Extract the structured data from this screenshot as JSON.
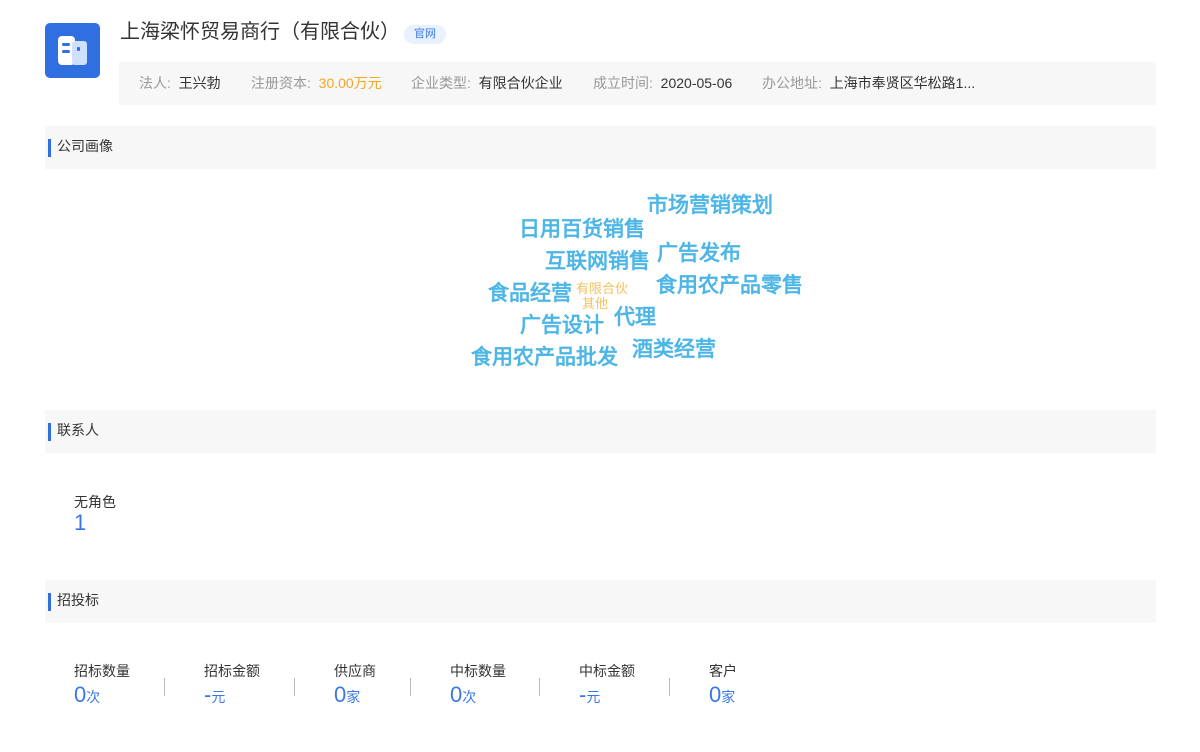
{
  "company": {
    "name": "上海梁怀贸易商行（有限合伙）",
    "official_tag": "官网"
  },
  "info": {
    "legal_rep_label": "法人:",
    "legal_rep": "王兴勃",
    "capital_label": "注册资本:",
    "capital": "30.00万元",
    "type_label": "企业类型:",
    "type": "有限合伙企业",
    "founded_label": "成立时间:",
    "founded": "2020-05-06",
    "address_label": "办公地址:",
    "address": "上海市奉贤区华松路1..."
  },
  "sections": {
    "profile": "公司画像",
    "contacts": "联系人",
    "bidding": "招投标"
  },
  "word_cloud": {
    "primary_color": "#4db6e6",
    "secondary_color": "#f5c15a",
    "words": [
      {
        "text": "市场营销策划"
      },
      {
        "text": "日用百货销售"
      },
      {
        "text": "互联网销售"
      },
      {
        "text": "广告发布"
      },
      {
        "text": "食品经营"
      },
      {
        "text": "有限合伙"
      },
      {
        "text": "其他"
      },
      {
        "text": "食用农产品零售"
      },
      {
        "text": "广告设计"
      },
      {
        "text": "代理"
      },
      {
        "text": "食用农产品批发"
      },
      {
        "text": "酒类经营"
      }
    ]
  },
  "contacts": {
    "role_label": "无角色",
    "role_count": "1"
  },
  "bidding": {
    "stats": [
      {
        "label": "招标数量",
        "value": "0",
        "unit": "次"
      },
      {
        "label": "招标金额",
        "value": "-",
        "unit": "元"
      },
      {
        "label": "供应商",
        "value": "0",
        "unit": "家"
      },
      {
        "label": "中标数量",
        "value": "0",
        "unit": "次"
      },
      {
        "label": "中标金额",
        "value": "-",
        "unit": "元"
      },
      {
        "label": "客户",
        "value": "0",
        "unit": "家"
      }
    ]
  }
}
